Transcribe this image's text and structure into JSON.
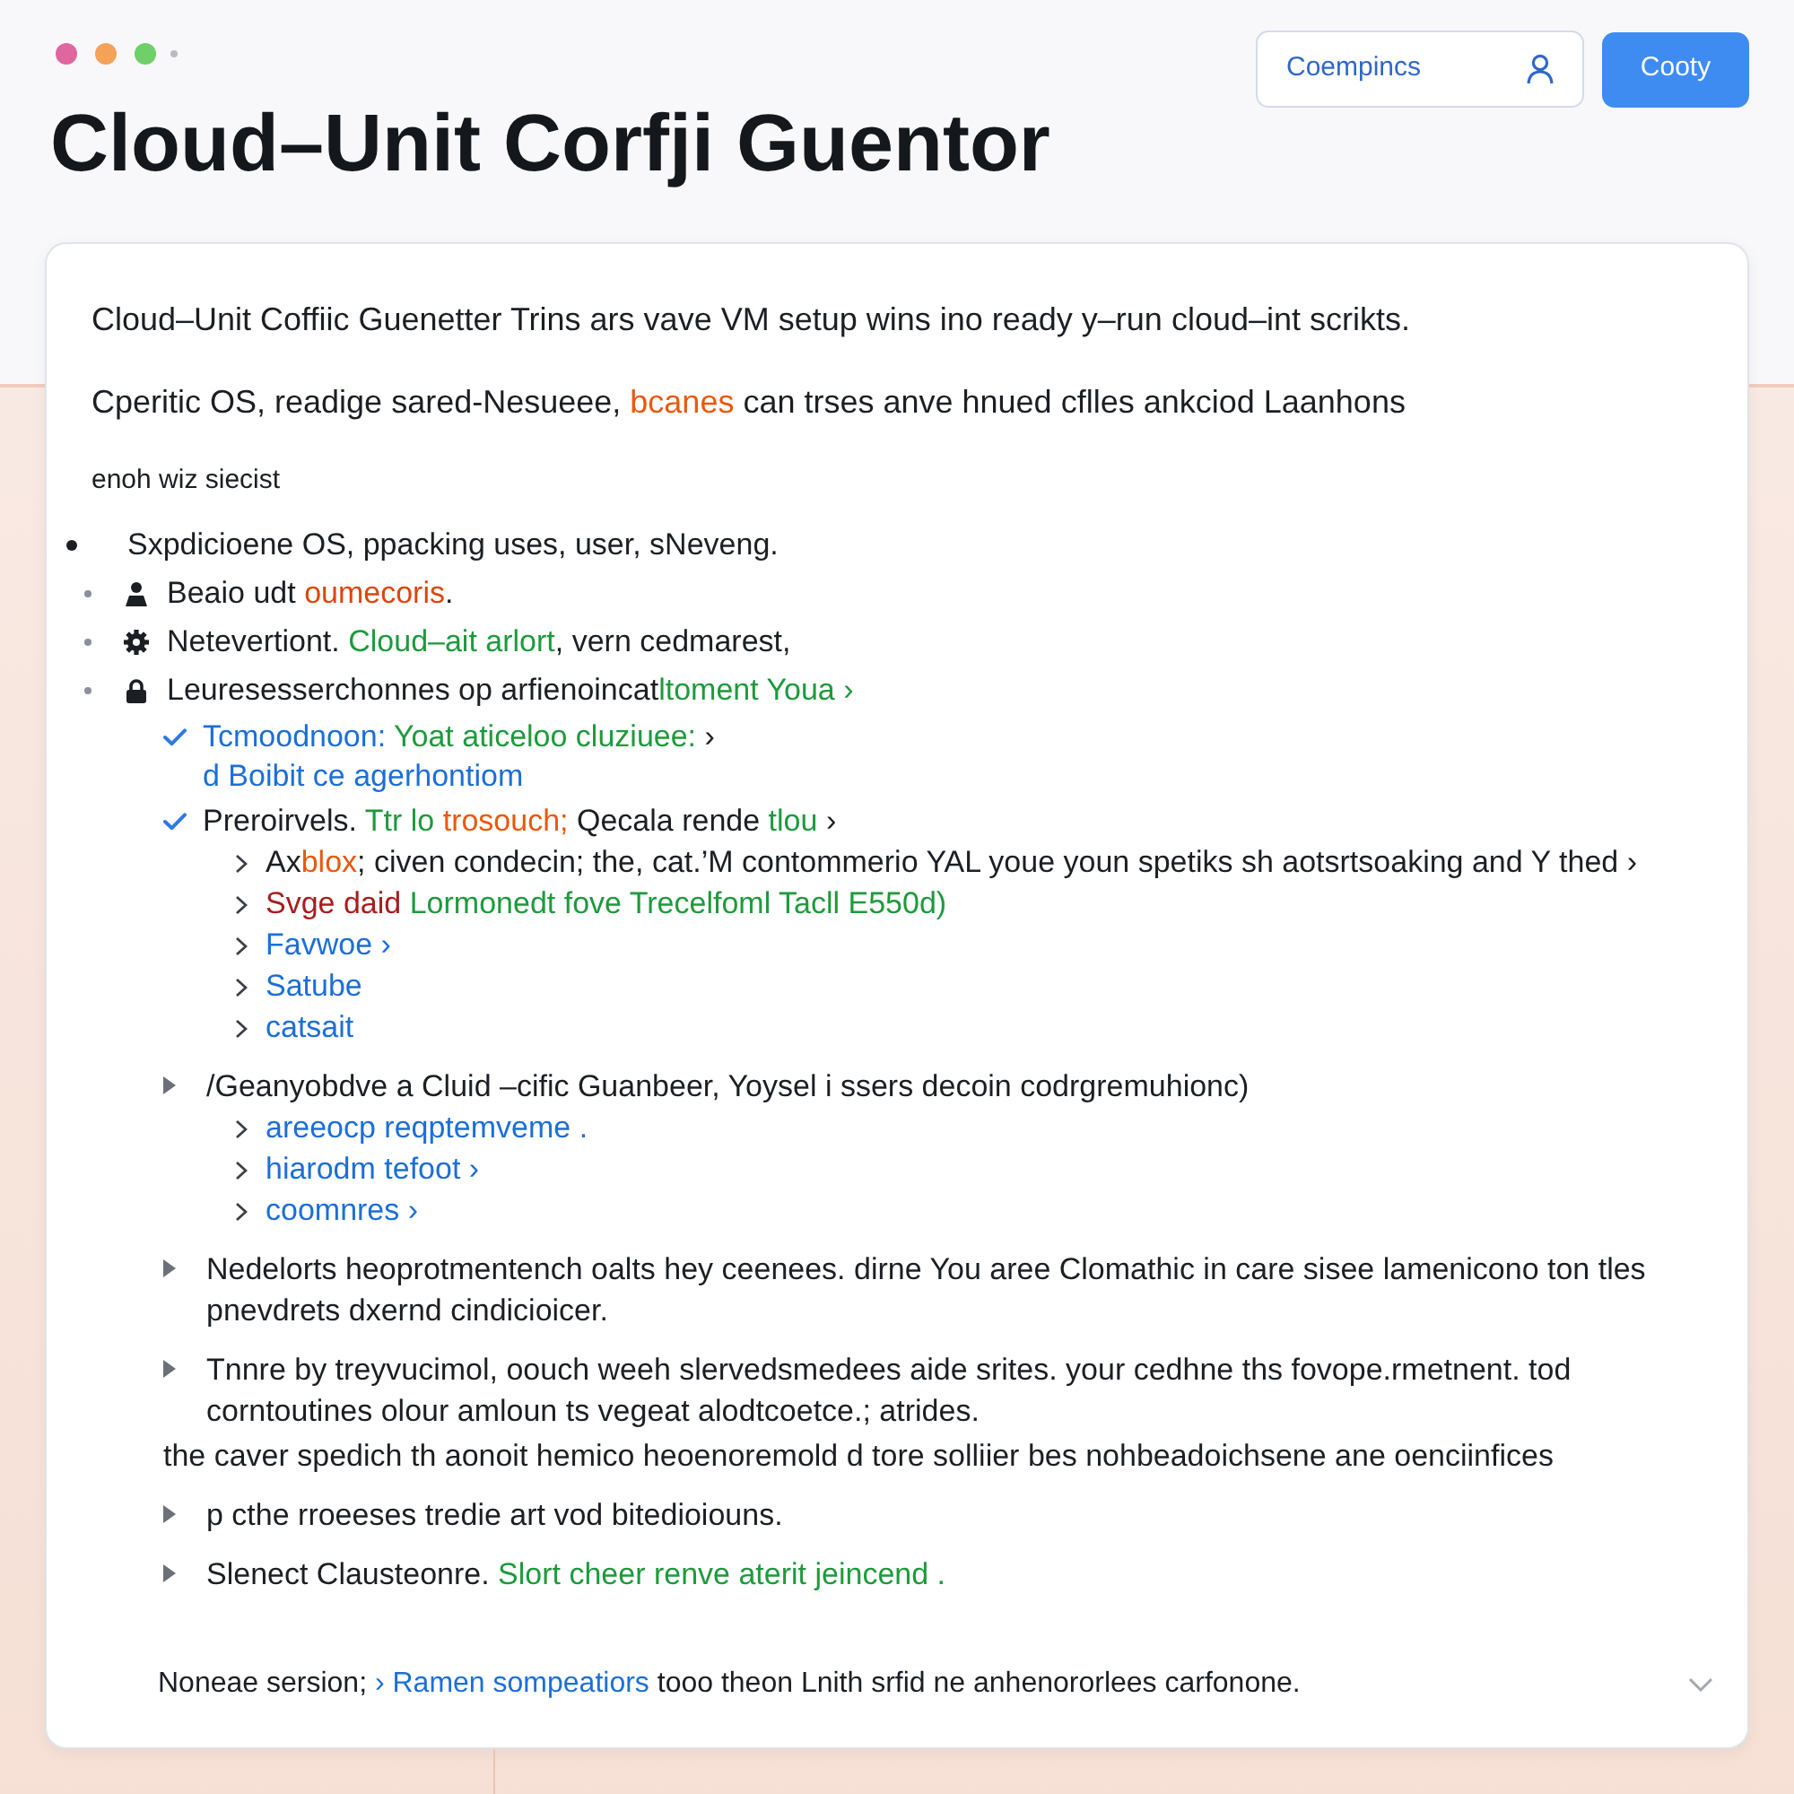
{
  "header": {
    "title": "Cloud–Unit Corfji Guentor",
    "buttons": [
      {
        "kind": "outline",
        "label": "Coempincs"
      },
      {
        "kind": "primary",
        "label": "Cooty"
      }
    ]
  },
  "card": {
    "intro": [
      {
        "kind": "lead",
        "segments": [
          {
            "text": "Cloud–Unit Coffiic Guenetter Trins ars vave VM setup wins ino ready y–run cloud–int scrikts."
          }
        ]
      },
      {
        "kind": "lead",
        "segments": [
          {
            "text": "Cperitic OS, readige sared-Nesueee, "
          },
          {
            "text": "bcanes",
            "color": "#e8590c"
          },
          {
            "text": " can trses anve hnued cflles ankciod Laanhons"
          }
        ]
      },
      {
        "kind": "caption",
        "segments": [
          {
            "text": "enoh wiz siecist"
          }
        ]
      }
    ],
    "outline": [
      {
        "kind": "bullet",
        "segments": [
          {
            "text": "Sxpdicioene OS, ppacking uses, user, sNeveng."
          }
        ]
      },
      {
        "kind": "icon_bullet",
        "segments": [
          {
            "text": "Beaio udt "
          },
          {
            "text": "oumecoris",
            "color": "#d9480f"
          },
          {
            "text": "."
          }
        ]
      },
      {
        "kind": "icon_bullet",
        "segments": [
          {
            "text": "Netevertiont. "
          },
          {
            "text": "Cloud–ait arlort",
            "color": "#1e9a3c"
          },
          {
            "text": ", vern cedmarest,"
          }
        ]
      },
      {
        "kind": "icon_bullet",
        "segments": [
          {
            "text": "Leuresesserchonnes op arfienoincat"
          },
          {
            "text": "ltoment Youa ›",
            "color": "#1e9a3c"
          }
        ],
        "children": [
          {
            "kind": "check",
            "segments": [
              {
                "text": "Tcmoodnoon: ",
                "color": "#1c6fd6"
              },
              {
                "text": "Yoat aticeloo cluziuee:",
                "color": "#1e9a3c"
              },
              {
                "text": " ›"
              }
            ],
            "subline": [
              {
                "text": "d Boibit ce agerhontiom",
                "color": "#1c6fd6"
              }
            ]
          },
          {
            "kind": "check",
            "segments": [
              {
                "text": "Preroirvels. "
              },
              {
                "text": "Ttr lo ",
                "color": "#1e9a3c"
              },
              {
                "text": "trosouch;",
                "color": "#e8590c"
              },
              {
                "text": " Qecala rende "
              },
              {
                "text": "tlou",
                "color": "#1e9a3c"
              },
              {
                "text": " ›"
              }
            ],
            "children": [
              {
                "kind": "chevron",
                "segments": [
                  {
                    "text": "Ax"
                  },
                  {
                    "text": "blox",
                    "color": "#e8590c"
                  },
                  {
                    "text": "; civen condecin; the, cat.’M contommerio YAL youe youn spetiks sh aotsrtsoaking and Y thed ›"
                  }
                ]
              },
              {
                "kind": "chevron",
                "segments": [
                  {
                    "text": "Svge daid ",
                    "color": "#a61e1e"
                  },
                  {
                    "text": "Lormonedt fove Trecelfoml Tacll E550d)",
                    "color": "#1e9a3c"
                  }
                ]
              },
              {
                "kind": "chevron",
                "segments": [
                  {
                    "text": "Favwoe ›",
                    "color": "#1c6fd6"
                  }
                ]
              },
              {
                "kind": "chevron",
                "segments": [
                  {
                    "text": "Satube",
                    "color": "#1c6fd6"
                  }
                ]
              },
              {
                "kind": "chevron",
                "segments": [
                  {
                    "text": "catsait",
                    "color": "#1c6fd6"
                  }
                ]
              }
            ]
          },
          {
            "kind": "triangle",
            "segments": [
              {
                "text": "/Geanyobdve a Cluid –cific Guanbeer, Yoysel i ssers decoin codrgremuhionc)"
              }
            ],
            "children": [
              {
                "kind": "chevron",
                "segments": [
                  {
                    "text": "areeocp reqptemveme .",
                    "color": "#1c6fd6"
                  }
                ]
              },
              {
                "kind": "chevron",
                "segments": [
                  {
                    "text": "hiarodm tefoot ›",
                    "color": "#1c6fd6"
                  }
                ]
              },
              {
                "kind": "chevron",
                "segments": [
                  {
                    "text": "coomnres ›",
                    "color": "#1c6fd6"
                  }
                ]
              }
            ]
          },
          {
            "kind": "triangle",
            "segments": [
              {
                "text": "Nedelorts heoprotmentench oalts hey ceenees. dirne You aree Clomathic in care sisee lamenicono ton tles pnevdrets dxernd cindicioicer."
              }
            ]
          },
          {
            "kind": "triangle",
            "segments": [
              {
                "text": "Tnnre by treyvucimol, oouch weeh slervedsmedees aide srites. your cedhne ths fovope.rmetnent. tod corntoutines olour amloun ts vegeat alodtcoetce.; atrides."
              }
            ]
          },
          {
            "kind": "plain",
            "segments": [
              {
                "text": "the caver spedich th aonoit hemico heoenoremold d tore solliier bes nohbeadoichsene ane oenciinfices"
              }
            ]
          },
          {
            "kind": "triangle",
            "segments": [
              {
                "text": "p cthe rroeeses tredie art vod bitedioiouns."
              }
            ]
          },
          {
            "kind": "triangle",
            "segments": [
              {
                "text": "Slenect Clausteonre. "
              },
              {
                "text": "Slort cheer renve aterit jeincend .",
                "color": "#1e9a3c"
              }
            ]
          }
        ]
      }
    ],
    "footer": {
      "segments": [
        {
          "text": "Noneae sersion; "
        },
        {
          "text": "› Ramen sompeatiors",
          "color": "#1c6fd6"
        },
        {
          "text": " tooo theon Lnith srfid ne anhenororlees carfonone."
        }
      ]
    }
  }
}
